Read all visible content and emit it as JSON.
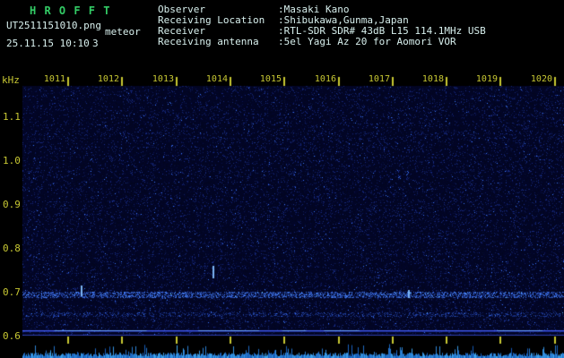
{
  "header": {
    "title": "H R O F F T",
    "filename": "UT2511151010.png",
    "tag": "meteor",
    "datetime": "25.11.15 10:10",
    "count": "3"
  },
  "station": {
    "rows": [
      {
        "label": "Observer",
        "value": ":Masaki Kano"
      },
      {
        "label": "Receiving Location",
        "value": ":Shibukawa,Gunma,Japan"
      },
      {
        "label": "Receiver",
        "value": ":RTL-SDR SDR# 43dB L15 114.1MHz USB"
      },
      {
        "label": "Receiving antenna",
        "value": ":5el Yagi Az 20 for Aomori VOR"
      }
    ]
  },
  "axes": {
    "y_unit": "kHz",
    "y_ticks": [
      "1.1",
      "1.0",
      "0.9",
      "0.8",
      "0.7",
      "0.6"
    ],
    "x_ticks": [
      "1011",
      "1012",
      "1013",
      "1014",
      "1015",
      "1016",
      "1017",
      "1018",
      "1019",
      "1020"
    ]
  },
  "signals": {
    "carrier_band_khz": 0.7,
    "sub_band_khz": 0.651,
    "baseline_khz": 0.612,
    "echoes": [
      {
        "t_frac": 0.351,
        "f_khz": [
          0.73,
          0.76
        ]
      },
      {
        "t_frac": 0.107,
        "f_khz": [
          0.69,
          0.715
        ]
      },
      {
        "t_frac": 0.712,
        "f_khz": [
          0.685,
          0.705
        ]
      }
    ]
  },
  "colors": {
    "title": "#33cc66",
    "text": "#d8f0ee",
    "axis": "#c8c833",
    "spectrogram_bg": "#000224",
    "noise_blue": "#2038c8",
    "band_blue": "#3c64ff",
    "smeter_cyan": "#2c9be0"
  }
}
